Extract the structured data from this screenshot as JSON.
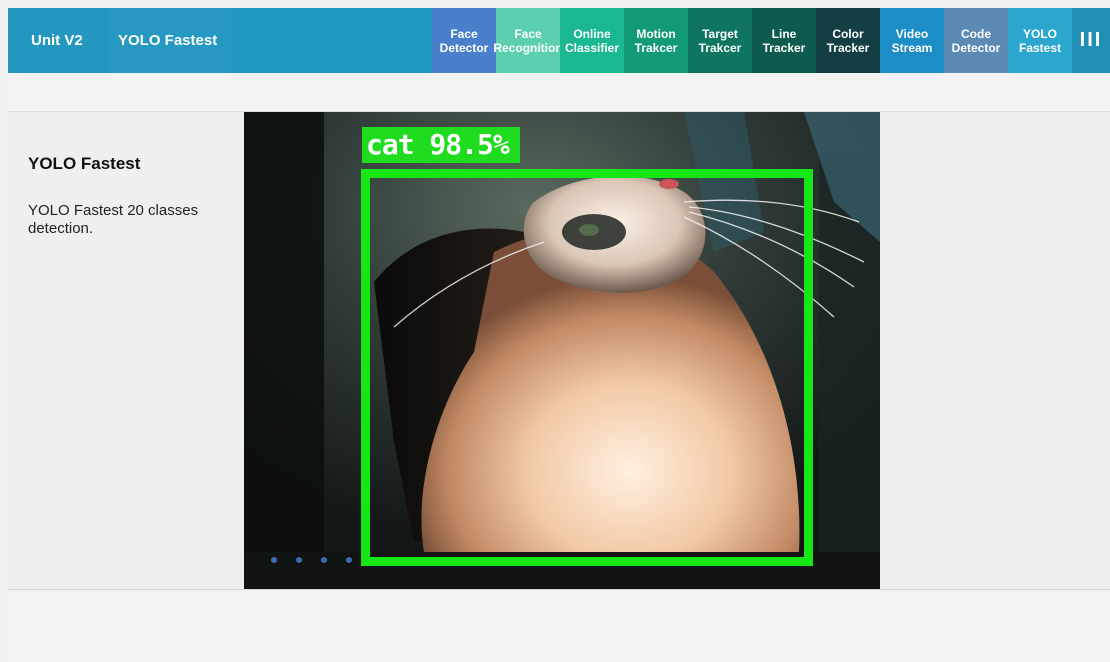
{
  "header": {
    "unit_label": "Unit V2",
    "current_app": "YOLO Fastest",
    "tabs": [
      {
        "label": "Face\nDetector",
        "color": "#4a7fcb"
      },
      {
        "label": "Face\nRecognition",
        "color": "#5ccfb0"
      },
      {
        "label": "Online\nClassifier",
        "color": "#19b890"
      },
      {
        "label": "Motion\nTrakcer",
        "color": "#129a76"
      },
      {
        "label": "Target\nTrakcer",
        "color": "#0f7560"
      },
      {
        "label": "Line\nTracker",
        "color": "#0d5b4f"
      },
      {
        "label": "Color\nTracker",
        "color": "#133f43"
      },
      {
        "label": "Video\nStream",
        "color": "#1c8dc6"
      },
      {
        "label": "Code\nDetector",
        "color": "#5b8bb5"
      },
      {
        "label": "YOLO\nFastest",
        "color": "#2ba6cf"
      }
    ],
    "menu_icon": "hamburger-icon"
  },
  "sidebar": {
    "title": "YOLO Fastest",
    "description": "YOLO Fastest 20 classes detection."
  },
  "detection": {
    "label": "cat 98.5%",
    "box_color": "#16e616"
  }
}
